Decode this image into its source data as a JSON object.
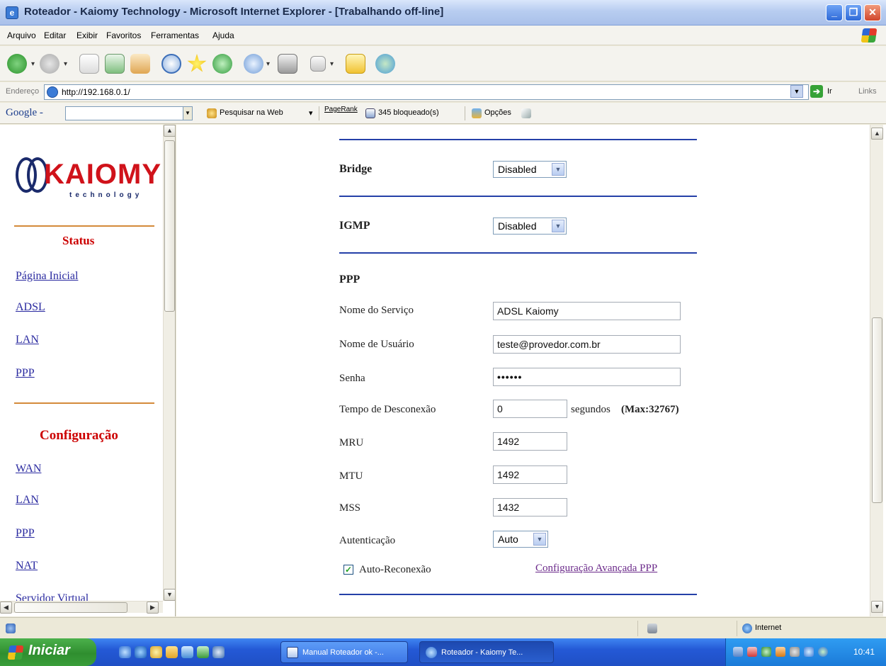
{
  "window": {
    "title": "Roteador - Kaiomy Technology - Microsoft Internet Explorer - [Trabalhando off-line]"
  },
  "menu": [
    "Arquivo",
    "Editar",
    "Exibir",
    "Favoritos",
    "Ferramentas",
    "Ajuda"
  ],
  "address": {
    "label": "Endereço",
    "url": "http://192.168.0.1/",
    "go_label": "Ir",
    "links_label": "Links"
  },
  "google_toolbar": {
    "logo": "Google -",
    "search_web": "Pesquisar na Web",
    "pagerank": "PageRank",
    "blocked": "345 bloqueado(s)",
    "options": "Opções"
  },
  "sidebar": {
    "logo_brand": "KAIOMY",
    "logo_sub": "technology",
    "status_heading": "Status",
    "status_links": [
      "Página Inicial",
      "ADSL",
      "LAN",
      "PPP"
    ],
    "config_heading": "Configuração",
    "config_links": [
      "WAN",
      "LAN",
      "PPP",
      "NAT",
      "Servidor Virtual"
    ]
  },
  "form": {
    "bridge_label": "Bridge",
    "bridge_value": "Disabled",
    "igmp_label": "IGMP",
    "igmp_value": "Disabled",
    "ppp_heading": "PPP",
    "service_label": "Nome do Serviço",
    "service_value": "ADSL Kaiomy",
    "user_label": "Nome de Usuário",
    "user_value": "teste@provedor.com.br",
    "password_label": "Senha",
    "password_value": "••••••",
    "timeout_label": "Tempo de Desconexão",
    "timeout_value": "0",
    "timeout_suffix_a": "segundos",
    "timeout_suffix_b": "(Max:32767)",
    "mru_label": "MRU",
    "mru_value": "1492",
    "mtu_label": "MTU",
    "mtu_value": "1492",
    "mss_label": "MSS",
    "mss_value": "1432",
    "auth_label": "Autenticação",
    "auth_value": "Auto",
    "reconnect_label": "Auto-Reconexão",
    "reconnect_checked": true,
    "advanced_link": "Configuração Avançada PPP"
  },
  "statusbar": {
    "zone": "Internet"
  },
  "taskbar": {
    "start_label": "Iniciar",
    "tasks": [
      "Manual Roteador ok -...",
      "Roteador - Kaiomy Te..."
    ],
    "clock": "10:41"
  }
}
